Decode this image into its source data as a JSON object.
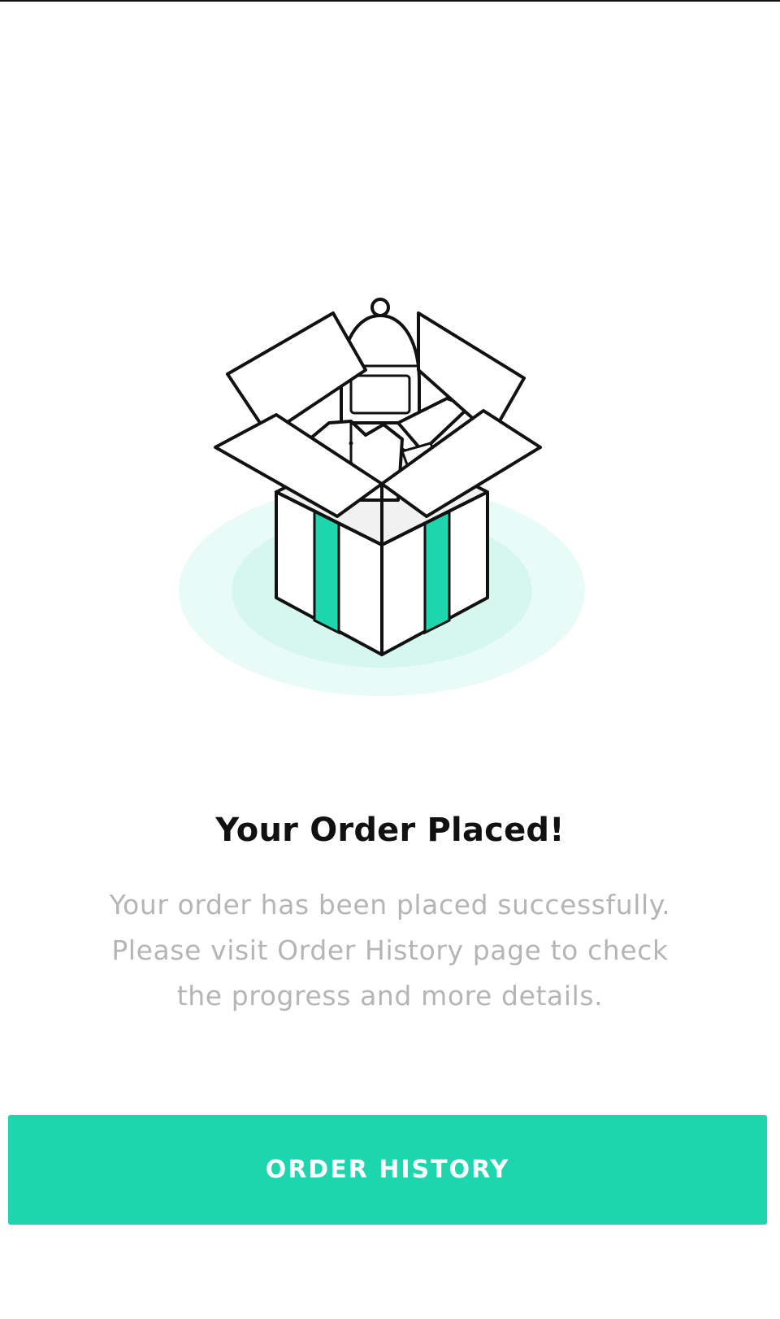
{
  "illustration": {
    "icon": "open-box-illustration",
    "accent_color": "#1dd6ad",
    "glow_color": "#dcfaf2"
  },
  "confirmation": {
    "title": "Your Order Placed!",
    "message_lines": [
      "Your order has been placed successfully.",
      "Please visit Order History page to check",
      "the progress and more details."
    ]
  },
  "actions": {
    "order_history_label": "ORDER HISTORY",
    "button_color": "#1dd6ad"
  }
}
